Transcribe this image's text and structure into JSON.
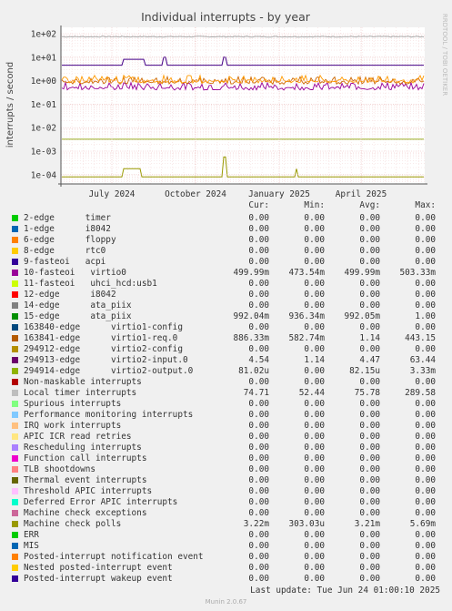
{
  "chart_data": {
    "type": "line",
    "title": "Individual interrupts - by year",
    "ylabel": "interrupts / second",
    "yscale": "log",
    "ylim": [
      5e-05,
      200
    ],
    "yticks": [
      "1e-04",
      "1e-03",
      "1e-02",
      "1e-01",
      "1e+00",
      "1e+01",
      "1e+02"
    ],
    "xticks": [
      "July 2024",
      "October 2024",
      "January 2025",
      "April 2025"
    ],
    "side_label": "RRDTOOL / TOBI OETIKER",
    "grid": true,
    "series": [
      {
        "name": "Local timer interrupts",
        "color": "#aaaaaa",
        "level": 74.71
      },
      {
        "name": "virtio0",
        "color": "#990099",
        "level": 0.49999
      },
      {
        "name": "virtio1-req.0",
        "color": "#cc6600",
        "level": 0.88633
      },
      {
        "name": "ata_piix",
        "color": "#ff9900",
        "level": 0.99204
      },
      {
        "name": "virtio2-input.0",
        "color": "#440088",
        "level": 4.54
      },
      {
        "name": "virtio2-output.0",
        "color": "#999900",
        "level": 8.102e-05
      },
      {
        "name": "Machine check polls",
        "color": "#99aa22",
        "level": 0.00322
      }
    ]
  },
  "legend": {
    "headers": [
      "Cur:",
      "Min:",
      "Avg:",
      "Max:"
    ],
    "rows": [
      {
        "label": "2-edge      timer",
        "color": "#00cc00",
        "cur": "0.00",
        "min": "0.00",
        "avg": "0.00",
        "max": "0.00"
      },
      {
        "label": "1-edge      i8042",
        "color": "#0066b3",
        "cur": "0.00",
        "min": "0.00",
        "avg": "0.00",
        "max": "0.00"
      },
      {
        "label": "6-edge      floppy",
        "color": "#ff8000",
        "cur": "0.00",
        "min": "0.00",
        "avg": "0.00",
        "max": "0.00"
      },
      {
        "label": "8-edge      rtc0",
        "color": "#ffcc00",
        "cur": "0.00",
        "min": "0.00",
        "avg": "0.00",
        "max": "0.00"
      },
      {
        "label": "9-fasteoi   acpi",
        "color": "#330099",
        "cur": "0.00",
        "min": "0.00",
        "avg": "0.00",
        "max": "0.00"
      },
      {
        "label": "10-fasteoi   virtio0",
        "color": "#990099",
        "cur": "499.99m",
        "min": "473.54m",
        "avg": "499.99m",
        "max": "503.33m"
      },
      {
        "label": "11-fasteoi   uhci_hcd:usb1",
        "color": "#ccff00",
        "cur": "0.00",
        "min": "0.00",
        "avg": "0.00",
        "max": "0.00"
      },
      {
        "label": "12-edge      i8042",
        "color": "#ff0000",
        "cur": "0.00",
        "min": "0.00",
        "avg": "0.00",
        "max": "0.00"
      },
      {
        "label": "14-edge      ata_piix",
        "color": "#808080",
        "cur": "0.00",
        "min": "0.00",
        "avg": "0.00",
        "max": "0.00"
      },
      {
        "label": "15-edge      ata_piix",
        "color": "#008f00",
        "cur": "992.04m",
        "min": "936.34m",
        "avg": "992.05m",
        "max": "1.00"
      },
      {
        "label": "163840-edge      virtio1-config",
        "color": "#00487d",
        "cur": "0.00",
        "min": "0.00",
        "avg": "0.00",
        "max": "0.00"
      },
      {
        "label": "163841-edge      virtio1-req.0",
        "color": "#b35a00",
        "cur": "886.33m",
        "min": "582.74m",
        "avg": "1.14",
        "max": "443.15"
      },
      {
        "label": "294912-edge      virtio2-config",
        "color": "#b38f00",
        "cur": "0.00",
        "min": "0.00",
        "avg": "0.00",
        "max": "0.00"
      },
      {
        "label": "294913-edge      virtio2-input.0",
        "color": "#6b006b",
        "cur": "4.54",
        "min": "1.14",
        "avg": "4.47",
        "max": "63.44"
      },
      {
        "label": "294914-edge      virtio2-output.0",
        "color": "#8fb300",
        "cur": "81.02u",
        "min": "0.00",
        "avg": "82.15u",
        "max": "3.33m"
      },
      {
        "label": "Non-maskable interrupts",
        "color": "#b30000",
        "cur": "0.00",
        "min": "0.00",
        "avg": "0.00",
        "max": "0.00"
      },
      {
        "label": "Local timer interrupts",
        "color": "#bebebe",
        "cur": "74.71",
        "min": "52.44",
        "avg": "75.78",
        "max": "289.58"
      },
      {
        "label": "Spurious interrupts",
        "color": "#80ff80",
        "cur": "0.00",
        "min": "0.00",
        "avg": "0.00",
        "max": "0.00"
      },
      {
        "label": "Performance monitoring interrupts",
        "color": "#80c9ff",
        "cur": "0.00",
        "min": "0.00",
        "avg": "0.00",
        "max": "0.00"
      },
      {
        "label": "IRQ work interrupts",
        "color": "#ffc080",
        "cur": "0.00",
        "min": "0.00",
        "avg": "0.00",
        "max": "0.00"
      },
      {
        "label": "APIC ICR read retries",
        "color": "#ffe680",
        "cur": "0.00",
        "min": "0.00",
        "avg": "0.00",
        "max": "0.00"
      },
      {
        "label": "Rescheduling interrupts",
        "color": "#aa80ff",
        "cur": "0.00",
        "min": "0.00",
        "avg": "0.00",
        "max": "0.00"
      },
      {
        "label": "Function call interrupts",
        "color": "#ee00cc",
        "cur": "0.00",
        "min": "0.00",
        "avg": "0.00",
        "max": "0.00"
      },
      {
        "label": "TLB shootdowns",
        "color": "#ff8080",
        "cur": "0.00",
        "min": "0.00",
        "avg": "0.00",
        "max": "0.00"
      },
      {
        "label": "Thermal event interrupts",
        "color": "#666600",
        "cur": "0.00",
        "min": "0.00",
        "avg": "0.00",
        "max": "0.00"
      },
      {
        "label": "Threshold APIC interrupts",
        "color": "#ffbfff",
        "cur": "0.00",
        "min": "0.00",
        "avg": "0.00",
        "max": "0.00"
      },
      {
        "label": "Deferred Error APIC interrupts",
        "color": "#00ffcc",
        "cur": "0.00",
        "min": "0.00",
        "avg": "0.00",
        "max": "0.00"
      },
      {
        "label": "Machine check exceptions",
        "color": "#cc6699",
        "cur": "0.00",
        "min": "0.00",
        "avg": "0.00",
        "max": "0.00"
      },
      {
        "label": "Machine check polls",
        "color": "#999900",
        "cur": "3.22m",
        "min": "303.03u",
        "avg": "3.21m",
        "max": "5.69m"
      },
      {
        "label": "ERR",
        "color": "#00cc00",
        "cur": "0.00",
        "min": "0.00",
        "avg": "0.00",
        "max": "0.00"
      },
      {
        "label": "MIS",
        "color": "#0066b3",
        "cur": "0.00",
        "min": "0.00",
        "avg": "0.00",
        "max": "0.00"
      },
      {
        "label": "Posted-interrupt notification event",
        "color": "#ff8000",
        "cur": "0.00",
        "min": "0.00",
        "avg": "0.00",
        "max": "0.00"
      },
      {
        "label": "Nested posted-interrupt event",
        "color": "#ffcc00",
        "cur": "0.00",
        "min": "0.00",
        "avg": "0.00",
        "max": "0.00"
      },
      {
        "label": "Posted-interrupt wakeup event",
        "color": "#330099",
        "cur": "0.00",
        "min": "0.00",
        "avg": "0.00",
        "max": "0.00"
      }
    ]
  },
  "footer": {
    "last_update": "Last update: Tue Jun 24 01:00:10 2025",
    "munin": "Munin 2.0.67"
  }
}
